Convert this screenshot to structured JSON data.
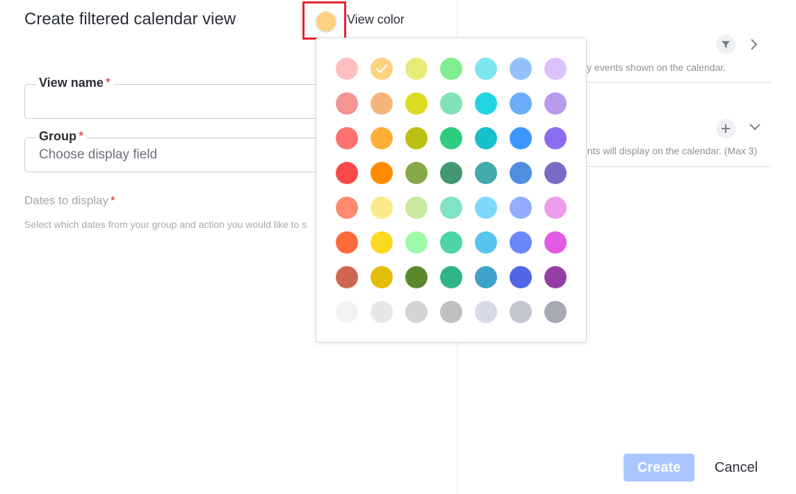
{
  "title": "Create filtered calendar view",
  "view_color": {
    "label": "View color",
    "selected": "#ffd27f"
  },
  "fields": {
    "view_name": {
      "label": "View name",
      "required_mark": "*",
      "value": ""
    },
    "group": {
      "label": "Group",
      "required_mark": "*",
      "placeholder": "Choose display field"
    }
  },
  "dates": {
    "label": "Dates to display",
    "required_mark": "*",
    "hint": "Select which dates from your group and action you would like to s"
  },
  "right_panel": {
    "filter_hint": "cify events shown on the calendar.",
    "events_hint": "vents will display on the calendar. (Max 3)"
  },
  "actions": {
    "create_label": "Create",
    "cancel_label": "Cancel"
  },
  "palette": {
    "selected_index": 1,
    "colors": [
      "#ffbfbf",
      "#ffd27f",
      "#e8eb7a",
      "#80ee90",
      "#7ee6ee",
      "#94c1fb",
      "#dcc1fd",
      "#f49494",
      "#f5b57a",
      "#dbdc23",
      "#7fe3b6",
      "#22d4e1",
      "#6aaef9",
      "#b99aec",
      "#fe7272",
      "#ffae38",
      "#bcbf14",
      "#2dcd7d",
      "#17c1c9",
      "#3d97fb",
      "#8b6cf1",
      "#f94a4a",
      "#ff8b00",
      "#86a94a",
      "#439871",
      "#41aaaa",
      "#4e90de",
      "#7b6bc4",
      "#ff8a70",
      "#fbea8c",
      "#c8e9a0",
      "#7fe3c6",
      "#7dd9fb",
      "#94acfd",
      "#eb9cef",
      "#ff6a3a",
      "#ffd820",
      "#9efbaa",
      "#4cd3a6",
      "#56c6ef",
      "#6b88fb",
      "#e05ae5",
      "#cf664f",
      "#e3be08",
      "#5b882c",
      "#2fb48a",
      "#3fa2c8",
      "#5066e4",
      "#953fa5",
      "#f3f3f3",
      "#e7e7e7",
      "#d4d4d4",
      "#c1c1c1",
      "#d8dbe6",
      "#c3c5d1",
      "#a7aab6"
    ]
  }
}
